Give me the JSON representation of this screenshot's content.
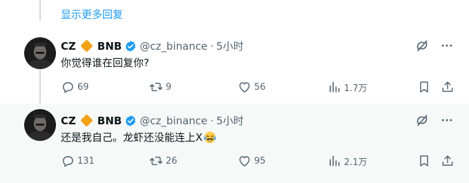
{
  "thread": {
    "more_replies_label": "显示更多回复"
  },
  "tweets": [
    {
      "display_name": "CZ",
      "name_suffix": "BNB",
      "handle": "@cz_binance",
      "separator": "·",
      "time": "5小时",
      "text": "你觉得谁在回复你?",
      "emoji": "",
      "replies": "69",
      "reposts": "9",
      "likes": "56",
      "views": "1.7万"
    },
    {
      "display_name": "CZ",
      "name_suffix": "BNB",
      "handle": "@cz_binance",
      "separator": "·",
      "time": "5小时",
      "text": "还是我自己。龙虾还没能连上X",
      "emoji": "face-with-tears-of-joy",
      "replies": "131",
      "reposts": "26",
      "likes": "95",
      "views": "2.1万"
    }
  ],
  "colors": {
    "accent": "#1d9bf0",
    "secondary_text": "#536471",
    "diamond": "#f3a117",
    "thread_line": "#cfd9de"
  }
}
